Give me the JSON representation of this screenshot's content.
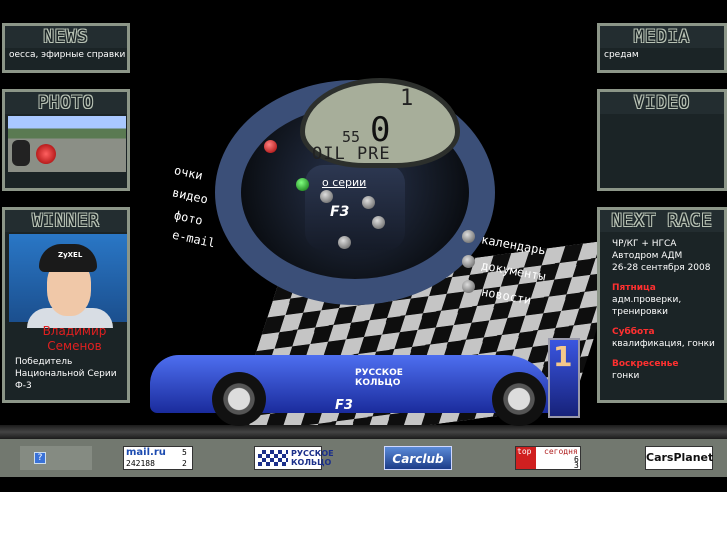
{
  "panels": {
    "news": {
      "title": "NEWS",
      "ticker": "оесса, эфирные справки т"
    },
    "media": {
      "title": "MEDIA",
      "ticker": "средам"
    },
    "photo": {
      "title": "PHOTO"
    },
    "video": {
      "title": "VIDEO"
    },
    "winner": {
      "title": "WINNER",
      "name_line1": "Владимир",
      "name_line2": "Семенов",
      "desc_line1": "Победитель",
      "desc_line2": "Национальной Серии",
      "desc_line3": "Ф-3"
    },
    "next_race": {
      "title": "NEXT RACE",
      "line1": "ЧР/КГ + НГСА",
      "line2": "Автодром АДМ",
      "line3": "26-28 сентября 2008",
      "days": [
        {
          "day": "Пятница",
          "text1": "адм.проверки,",
          "text2": "тренировки"
        },
        {
          "day": "Суббота",
          "text1": "квалификация, гонки",
          "text2": ""
        },
        {
          "day": "Воскресенье",
          "text1": "гонки",
          "text2": ""
        }
      ]
    }
  },
  "menu_left": [
    "очки",
    "видео",
    "фото",
    "e-mail"
  ],
  "menu_right": [
    "календарь",
    "документы",
    "новости"
  ],
  "about_link": "о серии",
  "dashboard": {
    "big": "0",
    "small": "55",
    "gear": "1",
    "oil": "OIL PRE"
  },
  "hub_logo": "F3",
  "car": {
    "text1": "РУССКОЕ",
    "text2": "КОЛЬЦО",
    "number": "1",
    "logo": "F3"
  },
  "helmet_badge": "ZyXEL",
  "banners": {
    "help_label": "?",
    "mail_logo": "mail.ru",
    "mail_num1": "5",
    "mail_count": "242188",
    "mail_num2": "2",
    "ring_line1": "РУССКОЕ",
    "ring_line2": "КОЛЬЦО",
    "carclub": "Carclub",
    "top_label": "top",
    "top_today": "сегодня",
    "top_num1": "6",
    "top_num2": "3",
    "carsplanet": "CarsPlanet"
  },
  "colors": {
    "panel_border": "#8c9688",
    "panel_bg": "#1b2426",
    "accent_red": "#e02020",
    "bar": "#72786f"
  }
}
